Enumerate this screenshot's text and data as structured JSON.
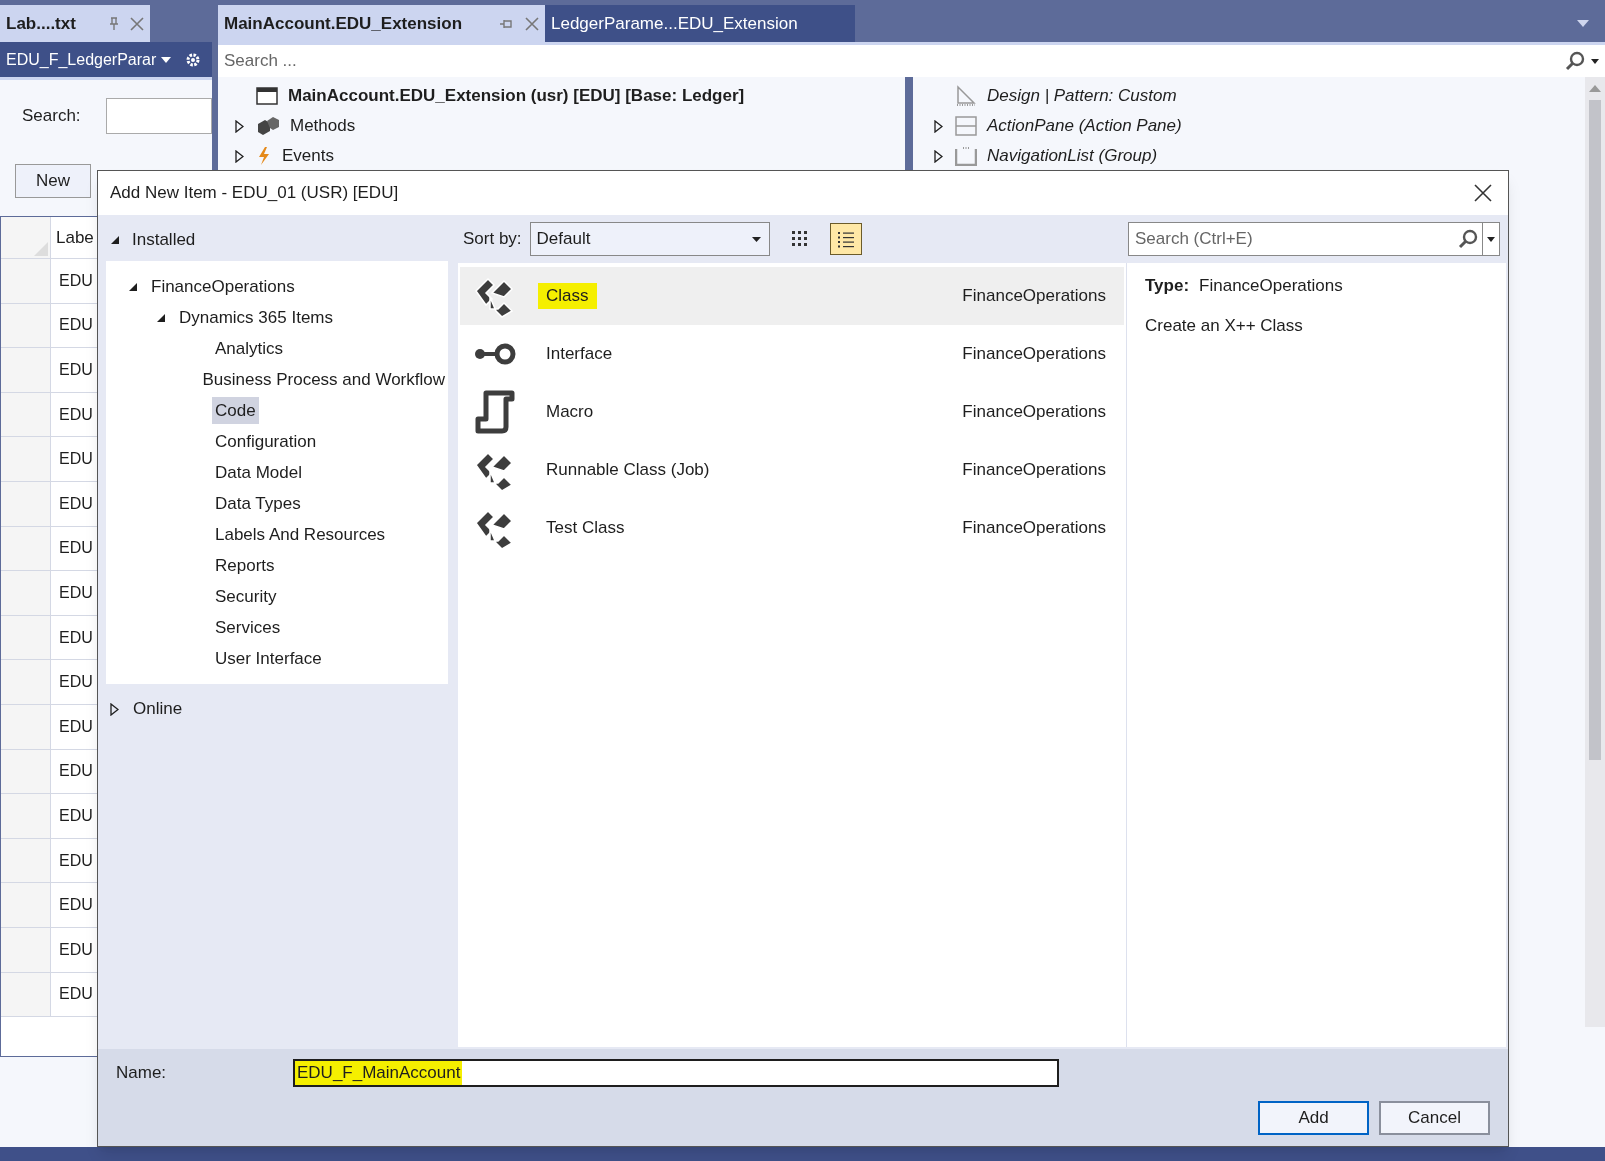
{
  "left_tab": {
    "label": "Lab....txt",
    "selected": true
  },
  "tabs": [
    {
      "label": "MainAccount.EDU_Extension",
      "selected": true
    },
    {
      "label": "LedgerParame...EDU_Extension",
      "selected": false
    }
  ],
  "left_panel": {
    "dropdown": "EDU_F_LedgerParar",
    "search_label": "Search:",
    "new_button": "New",
    "grid": {
      "header": "Labe",
      "rows": [
        "EDU",
        "EDU",
        "EDU",
        "EDU",
        "EDU",
        "EDU",
        "EDU",
        "EDU",
        "EDU",
        "EDU",
        "EDU",
        "EDU",
        "EDU",
        "EDU",
        "EDU",
        "EDU",
        "EDU"
      ]
    }
  },
  "editor": {
    "search": {
      "placeholder": "Search ..."
    },
    "tree": [
      {
        "label": "MainAccount.EDU_Extension (usr) [EDU] [Base: Ledger]",
        "kind": "root"
      },
      {
        "label": "Methods",
        "kind": "methods",
        "expanded": false
      },
      {
        "label": "Events",
        "kind": "events",
        "expanded": false
      }
    ],
    "design": [
      {
        "label": "Design | Pattern: Custom",
        "kind": "design"
      },
      {
        "label": "ActionPane (Action Pane)",
        "kind": "pane",
        "expanded": false
      },
      {
        "label": "NavigationList (Group)",
        "kind": "group",
        "expanded": false
      }
    ]
  },
  "dialog": {
    "title": "Add New Item - EDU_01 (USR) [EDU]",
    "installed": {
      "label": "Installed",
      "expanded": true,
      "children": [
        {
          "label": "FinanceOperations",
          "expanded": true,
          "selected": false,
          "children": [
            {
              "label": "Dynamics 365 Items",
              "expanded": true,
              "selected": false,
              "children": [
                {
                  "label": "Analytics",
                  "selected": false
                },
                {
                  "label": "Business Process and Workflow",
                  "selected": false
                },
                {
                  "label": "Code",
                  "selected": true
                },
                {
                  "label": "Configuration",
                  "selected": false
                },
                {
                  "label": "Data Model",
                  "selected": false
                },
                {
                  "label": "Data Types",
                  "selected": false
                },
                {
                  "label": "Labels And Resources",
                  "selected": false
                },
                {
                  "label": "Reports",
                  "selected": false
                },
                {
                  "label": "Security",
                  "selected": false
                },
                {
                  "label": "Services",
                  "selected": false
                },
                {
                  "label": "User Interface",
                  "selected": false
                }
              ]
            }
          ]
        }
      ]
    },
    "online": {
      "label": "Online",
      "expanded": false
    },
    "sort_label": "Sort by:",
    "sort_value": "Default",
    "views": [
      {
        "kind": "grid",
        "selected": false
      },
      {
        "kind": "list",
        "selected": true
      }
    ],
    "search": {
      "placeholder": "Search (Ctrl+E)"
    },
    "items": [
      {
        "name": "Class",
        "kind": "class",
        "category": "FinanceOperations",
        "selected": true
      },
      {
        "name": "Interface",
        "kind": "interface",
        "category": "FinanceOperations",
        "selected": false
      },
      {
        "name": "Macro",
        "kind": "macro",
        "category": "FinanceOperations",
        "selected": false
      },
      {
        "name": "Runnable Class (Job)",
        "kind": "class",
        "category": "FinanceOperations",
        "selected": false
      },
      {
        "name": "Test Class",
        "kind": "class",
        "category": "FinanceOperations",
        "selected": false
      }
    ],
    "type_label": "Type:",
    "type_value": "FinanceOperations",
    "description": "Create an X++ Class",
    "name_label": "Name:",
    "name_value": "EDU_F_MainAccount",
    "buttons": [
      {
        "label": "Add",
        "kind": "default"
      },
      {
        "label": "Cancel",
        "kind": "normal"
      }
    ]
  }
}
